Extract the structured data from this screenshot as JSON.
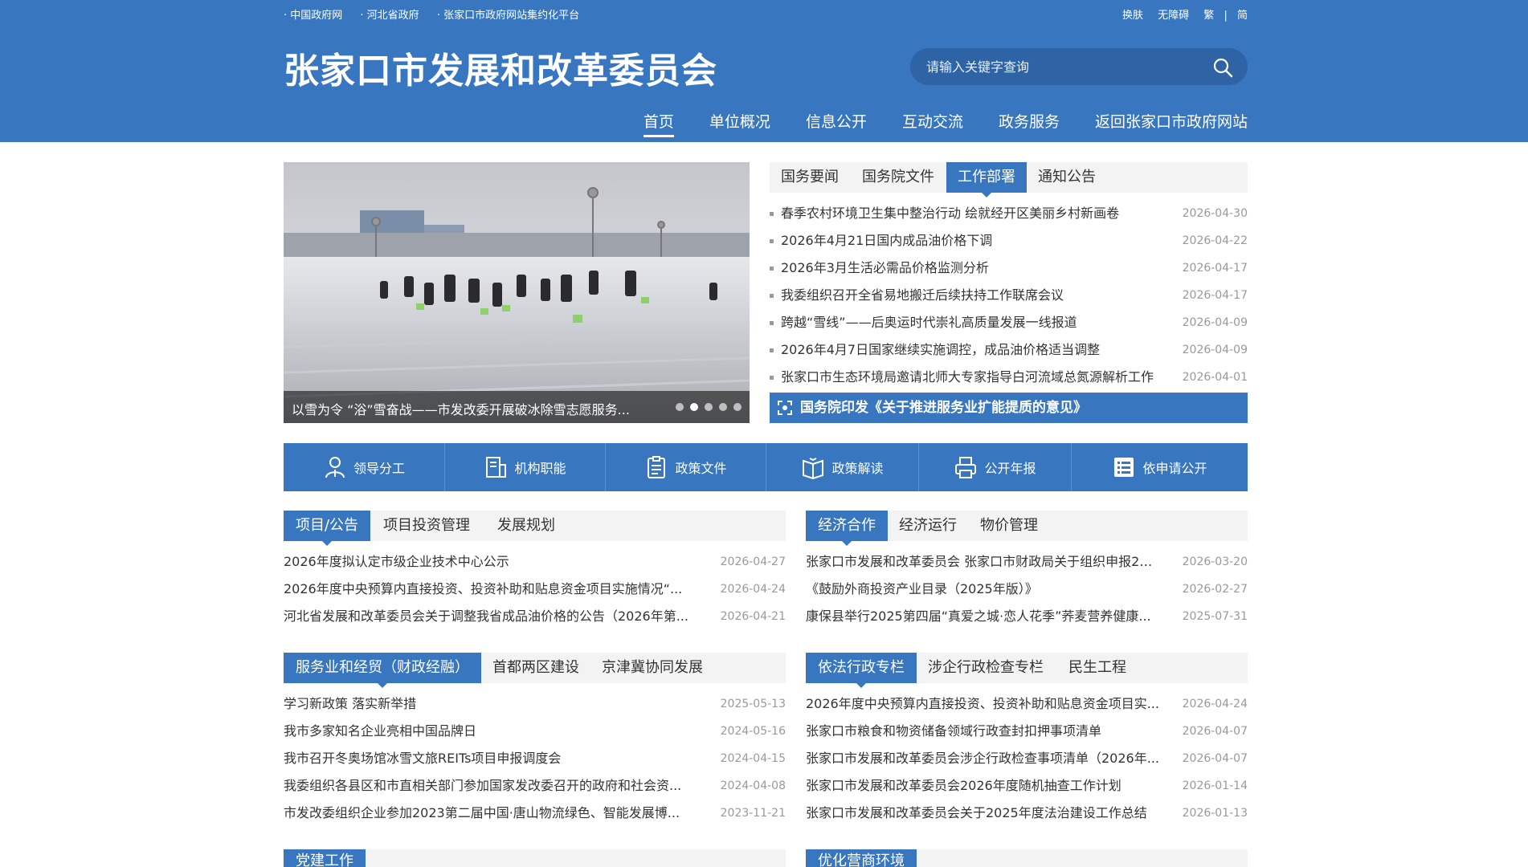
{
  "toplinks": {
    "left": [
      "· 中国政府网",
      "· 河北省政府",
      "· 张家口市政府网站集约化平台"
    ],
    "skin": "换肤",
    "accessible": "无障碍",
    "traditional": "繁",
    "separator": "|",
    "simplified": "简"
  },
  "site_title": "张家口市发展和改革委员会",
  "search": {
    "placeholder": "请输入关键字查询"
  },
  "nav": [
    "首页",
    "单位概况",
    "信息公开",
    "互动交流",
    "政务服务",
    "返回张家口市政府网站"
  ],
  "slider": {
    "caption": "以雪为令 “浴”雪奋战——市发改委开展破冰除雪志愿服务...",
    "dot_count": 5,
    "active_dot": 2
  },
  "news_panel": {
    "tabs": [
      "国务要闻",
      "国务院文件",
      "工作部署",
      "通知公告"
    ],
    "active_tab": 2,
    "items": [
      {
        "title": "春季农村环境卫生集中整治行动 绘就经开区美丽乡村新画卷",
        "date": "2026-04-30"
      },
      {
        "title": "2026年4月21日国内成品油价格下调",
        "date": "2026-04-22"
      },
      {
        "title": "2026年3月生活必需品价格监测分析",
        "date": "2026-04-17"
      },
      {
        "title": "我委组织召开全省易地搬迁后续扶持工作联席会议",
        "date": "2026-04-17"
      },
      {
        "title": "跨越“雪线”——后奥运时代崇礼高质量发展一线报道",
        "date": "2026-04-09"
      },
      {
        "title": "2026年4月7日国家继续实施调控，成品油价格适当调整",
        "date": "2026-04-09"
      },
      {
        "title": "张家口市生态环境局邀请北师大专家指导白河流域总氮源解析工作",
        "date": "2026-04-01"
      }
    ],
    "banner": "国务院印发《关于推进服务业扩能提质的意见》"
  },
  "quicklinks": [
    {
      "label": "领导分工",
      "icon": "person-icon"
    },
    {
      "label": "机构职能",
      "icon": "building-doc-icon"
    },
    {
      "label": "政策文件",
      "icon": "clipboard-icon"
    },
    {
      "label": "政策解读",
      "icon": "open-book-icon"
    },
    {
      "label": "公开年报",
      "icon": "printer-icon"
    },
    {
      "label": "依申请公开",
      "icon": "list-icon"
    }
  ],
  "section_projects": {
    "tabs": [
      "项目/公告",
      "项目投资管理",
      "发展规划"
    ],
    "active_tab": 0,
    "items": [
      {
        "title": "2026年度拟认定市级企业技术中心公示",
        "date": "2026-04-27"
      },
      {
        "title": "2026年度中央预算内直接投资、投资补助和贴息资金项目实施情况“...",
        "date": "2026-04-24"
      },
      {
        "title": "河北省发展和改革委员会关于调整我省成品油价格的公告（2026年第...",
        "date": "2026-04-21"
      }
    ]
  },
  "section_economy": {
    "tabs": [
      "经济合作",
      "经济运行",
      "物价管理"
    ],
    "active_tab": 0,
    "items": [
      {
        "title": "张家口市发展和改革委员会 张家口市财政局关于组织申报20...",
        "date": "2026-03-20"
      },
      {
        "title": "《鼓励外商投资产业目录（2025年版）》",
        "date": "2026-02-27"
      },
      {
        "title": "康保县举行2025第四届“真爱之城·恋人花季”荞麦营养健康...",
        "date": "2025-07-31"
      }
    ]
  },
  "section_services": {
    "tabs": [
      "服务业和经贸（财政经融）",
      "首都两区建设",
      "京津冀协同发展"
    ],
    "active_tab": 0,
    "items": [
      {
        "title": "学习新政策 落实新举措",
        "date": "2025-05-13"
      },
      {
        "title": "我市多家知名企业亮相中国品牌日",
        "date": "2024-05-16"
      },
      {
        "title": "我市召开冬奥场馆冰雪文旅REITs项目申报调度会",
        "date": "2024-04-15"
      },
      {
        "title": "我委组织各县区和市直相关部门参加国家发改委召开的政府和社会资...",
        "date": "2024-04-08"
      },
      {
        "title": "市发改委组织企业参加2023第二届中国·唐山物流绿色、智能发展博...",
        "date": "2023-11-21"
      }
    ]
  },
  "section_law": {
    "tabs": [
      "依法行政专栏",
      "涉企行政检查专栏",
      "民生工程"
    ],
    "active_tab": 0,
    "items": [
      {
        "title": "2026年度中央预算内直接投资、投资补助和贴息资金项目实...",
        "date": "2026-04-24"
      },
      {
        "title": "张家口市粮食和物资储备领域行政查封扣押事项清单",
        "date": "2026-04-07"
      },
      {
        "title": "张家口市发展和改革委员会涉企行政检查事项清单（2026年...",
        "date": "2026-04-07"
      },
      {
        "title": "张家口市发展和改革委员会2026年度随机抽查工作计划",
        "date": "2026-01-14"
      },
      {
        "title": "张家口市发展和改革委员会关于2025年度法治建设工作总结",
        "date": "2026-01-13"
      }
    ]
  },
  "section_party": {
    "tab": "党建工作"
  },
  "section_business": {
    "tab": "优化营商环境"
  },
  "colors": {
    "brand_blue": "#3876c0",
    "tab_bg": "#f3f3f3",
    "date_gray": "#999999"
  }
}
